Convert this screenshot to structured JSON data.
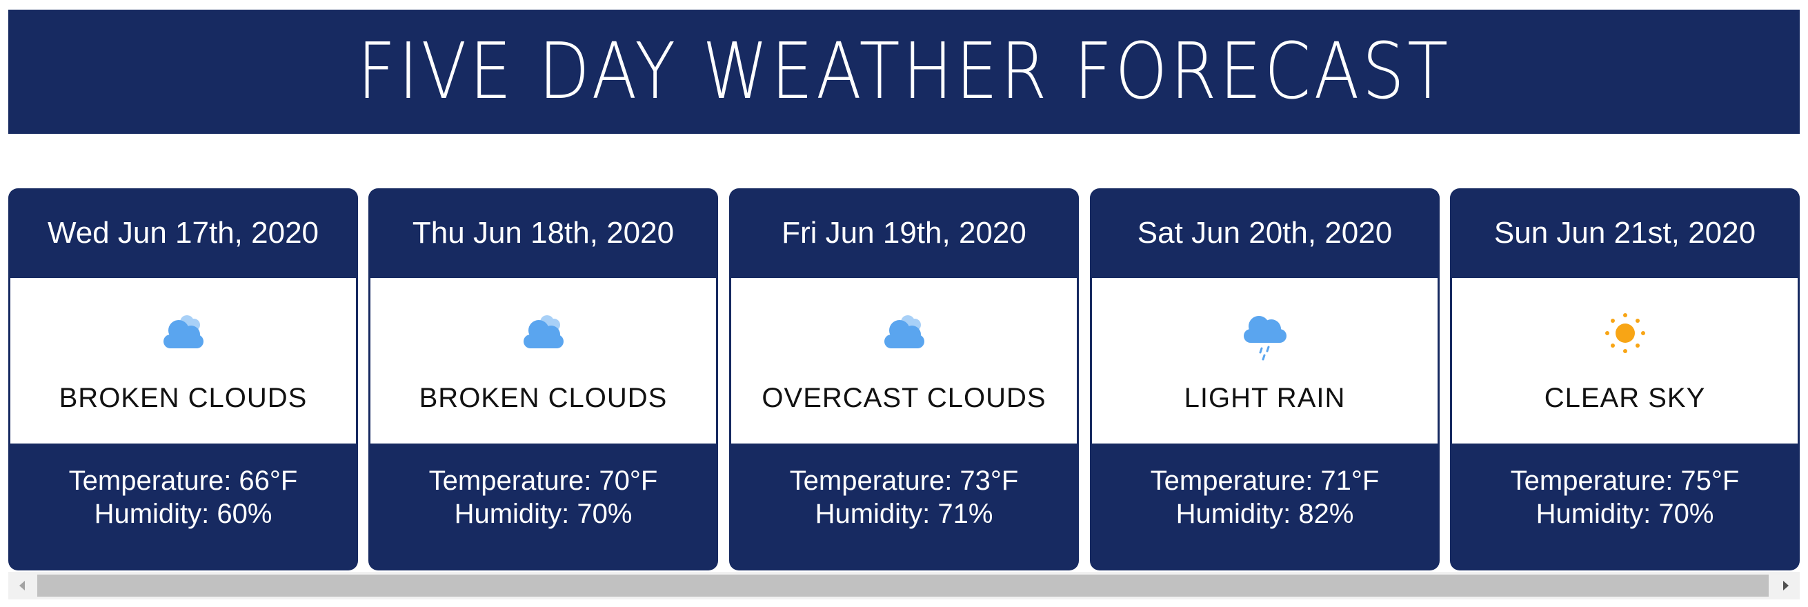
{
  "header": {
    "title": "FIVE DAY WEATHER FORECAST"
  },
  "colors": {
    "navy": "#172a61",
    "cloud_blue": "#5aa5ef",
    "cloud_light": "#a8d0f7",
    "sun_orange": "#f8a515",
    "scroll_thumb": "#c1c1c1"
  },
  "forecast": [
    {
      "date": "Wed Jun 17th, 2020",
      "icon": "broken-clouds-icon",
      "description": "BROKEN CLOUDS",
      "temperature": "Temperature: 66°F",
      "humidity": "Humidity: 60%"
    },
    {
      "date": "Thu Jun 18th, 2020",
      "icon": "broken-clouds-icon",
      "description": "BROKEN CLOUDS",
      "temperature": "Temperature: 70°F",
      "humidity": "Humidity: 70%"
    },
    {
      "date": "Fri Jun 19th, 2020",
      "icon": "broken-clouds-icon",
      "description": "OVERCAST CLOUDS",
      "temperature": "Temperature: 73°F",
      "humidity": "Humidity: 71%"
    },
    {
      "date": "Sat Jun 20th, 2020",
      "icon": "rain-cloud-icon",
      "description": "LIGHT RAIN",
      "temperature": "Temperature: 71°F",
      "humidity": "Humidity: 82%"
    },
    {
      "date": "Sun Jun 21st, 2020",
      "icon": "sun-icon",
      "description": "CLEAR SKY",
      "temperature": "Temperature: 75°F",
      "humidity": "Humidity: 70%"
    }
  ],
  "scrollbar": {
    "left_arrow_icon": "triangle-left-icon",
    "right_arrow_icon": "triangle-right-icon"
  }
}
